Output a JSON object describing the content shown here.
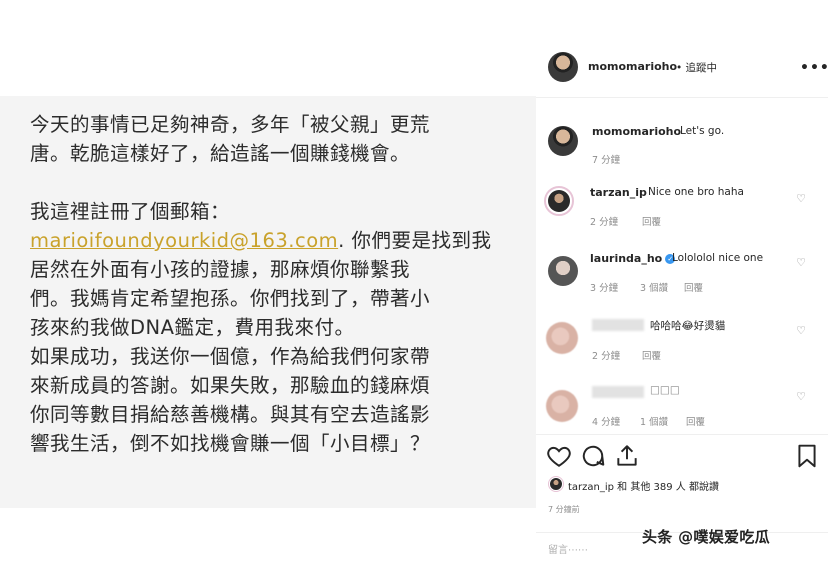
{
  "post": {
    "lines": [
      "今天的事情已足夠神奇，多年「被父親」更荒",
      "唐。乾脆這樣好了，給造謠一個賺錢機會。",
      "",
      "我這裡註冊了個郵箱：",
      "",
      "居然在外面有小孩的證據，那麻煩你聯繫我",
      "們。我媽肯定希望抱孫。你們找到了，帶著小",
      "孩來約我做DNA鑑定，費用我來付。",
      "如果成功，我送你一個億，作為給我們何家帶",
      "來新成員的答謝。如果失敗，那驗血的錢麻煩",
      "你同等數目捐給慈善機構。與其有空去造謠影",
      "響我生活，倒不如找機會賺一個「小目標」？"
    ],
    "email": "marioifoundyourkid@163.com",
    "email_suffix": ". 你們要是找到我"
  },
  "header": {
    "username": "momomarioho",
    "follow_status": "• 追蹤中",
    "more_icon": "•••"
  },
  "comments": [
    {
      "username": "momomarioho",
      "text": "Let's go.",
      "time": "7 分鐘"
    },
    {
      "username": "tarzan_ip",
      "text": "Nice one bro haha",
      "time": "2 分鐘",
      "reply": "回覆"
    },
    {
      "username": "laurinda_ho",
      "text": "Lolololol nice one",
      "time": "3 分鐘",
      "likes": "3 個讚",
      "reply": "回覆"
    },
    {
      "username": "",
      "text": "哈哈哈😂好燙貓",
      "time": "2 分鐘",
      "reply": "回覆"
    },
    {
      "username": "",
      "text": "□□□",
      "time": "4 分鐘",
      "likes": "1 個讚",
      "reply": "回覆"
    }
  ],
  "likes": {
    "text": "tarzan_ip 和 其他 389 人 都說讚"
  },
  "post_time": "7 分鐘前",
  "add_comment_placeholder": "留言⋯⋯",
  "watermark": "头条 @噗娱爱吃瓜",
  "colors": {
    "email": "#c9a22b",
    "verified": "#3897f0"
  },
  "icons": [
    "heart-icon",
    "comment-icon",
    "share-icon",
    "bookmark-icon",
    "more-icon",
    "verified-icon"
  ]
}
